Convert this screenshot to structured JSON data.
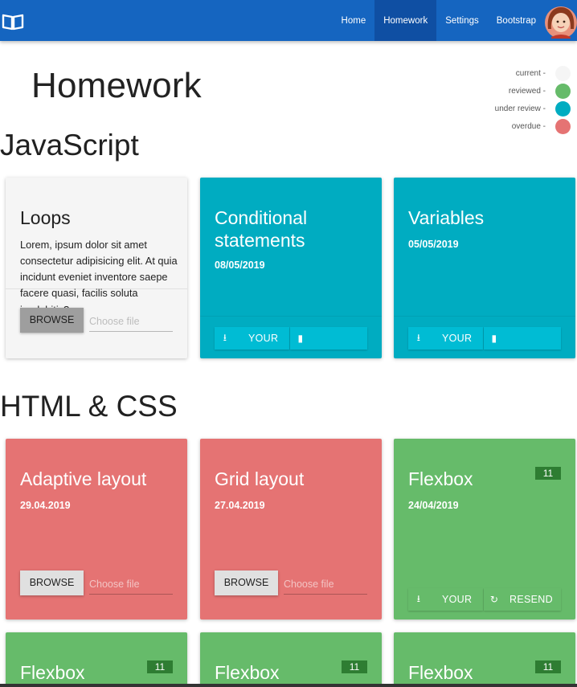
{
  "nav": {
    "items": [
      "Home",
      "Homework",
      "Settings",
      "Bootstrap"
    ],
    "active": 1
  },
  "page": {
    "title": "Homework"
  },
  "legend": [
    {
      "label": "current -",
      "color": "#f5f5f5"
    },
    {
      "label": "reviewed -",
      "color": "#66bb6a"
    },
    {
      "label": "under review -",
      "color": "#00acc1"
    },
    {
      "label": "overdue -",
      "color": "#e57373"
    }
  ],
  "sections": {
    "js": "JavaScript",
    "html": "HTML & CSS"
  },
  "cards": {
    "loops": {
      "title": "Loops",
      "text": "Lorem, ipsum dolor sit amet consectetur adipisicing elit. At quia incidunt eveniet inventore saepe facere quasi, facilis soluta",
      "overflow_text": "i... debitis?",
      "browse": "BROWSE",
      "file_placeholder": "Choose file"
    },
    "conditional": {
      "title": "Conditional statements",
      "date": "08/05/2019",
      "your": "YOUR"
    },
    "variables": {
      "title": "Variables",
      "date": "05/05/2019",
      "your": "YOUR"
    },
    "adaptive": {
      "title": "Adaptive layout",
      "date": "29.04.2019",
      "browse": "BROWSE",
      "file_placeholder": "Choose file"
    },
    "grid": {
      "title": "Grid layout",
      "date": "27.04.2019",
      "browse": "BROWSE",
      "file_placeholder": "Choose file"
    },
    "flexbox1": {
      "title": "Flexbox",
      "date": "24/04/2019",
      "badge": "11",
      "your": "YOUR",
      "resend": "RESEND"
    },
    "flexbox2": {
      "title": "Flexbox",
      "badge": "11"
    },
    "flexbox3": {
      "title": "Flexbox",
      "badge": "11"
    },
    "flexbox4": {
      "title": "Flexbox",
      "badge": "11"
    }
  },
  "colors": {
    "navbar": "#1565c0",
    "current": "#f5f5f5",
    "reviewed": "#66bb6a",
    "under_review": "#00acc1",
    "overdue": "#e57373"
  }
}
